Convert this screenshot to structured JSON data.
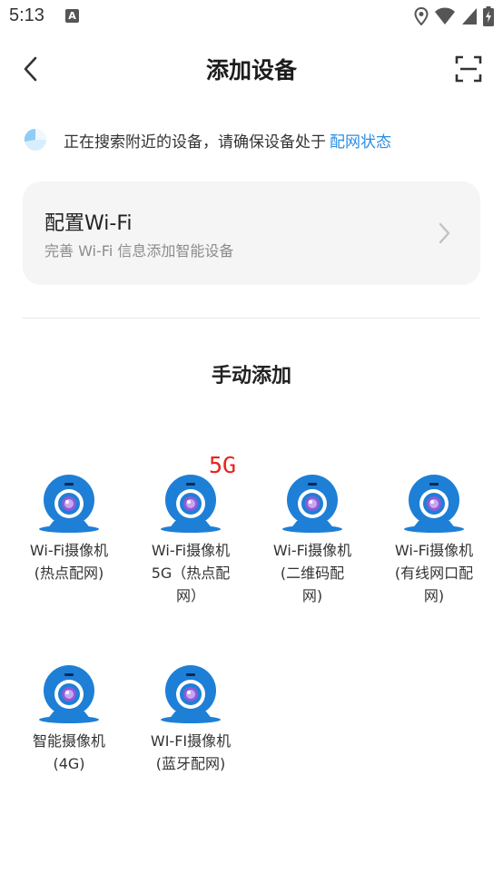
{
  "status_bar": {
    "time": "5:13",
    "app_icon_glyph": "A"
  },
  "header": {
    "title": "添加设备",
    "back_icon": "chevron-left-icon",
    "scan_icon": "scan-icon"
  },
  "search_notice": {
    "text": "正在搜索附近的设备，请确保设备处于",
    "link": "配网状态",
    "link_color": "#2b8ee6"
  },
  "wifi_card": {
    "title": "配置Wi-Fi",
    "subtitle": "完善 Wi-Fi 信息添加智能设备"
  },
  "manual_section": {
    "title": "手动添加"
  },
  "devices": [
    {
      "label": "Wi-Fi摄像机\n(热点配网)"
    },
    {
      "label": "Wi-Fi摄像机\n5G（热点配\n网）",
      "badge": "5G"
    },
    {
      "label": "Wi-Fi摄像机\n(二维码配\n网)"
    },
    {
      "label": "Wi-Fi摄像机\n(有线网口配\n网)"
    },
    {
      "label": "智能摄像机\n(4G)"
    },
    {
      "label": "WI-FI摄像机\n(蓝牙配网)"
    }
  ],
  "colors": {
    "camera_blue": "#1e7fd6",
    "badge_red": "#e8231b",
    "accent": "#2b8ee6"
  }
}
